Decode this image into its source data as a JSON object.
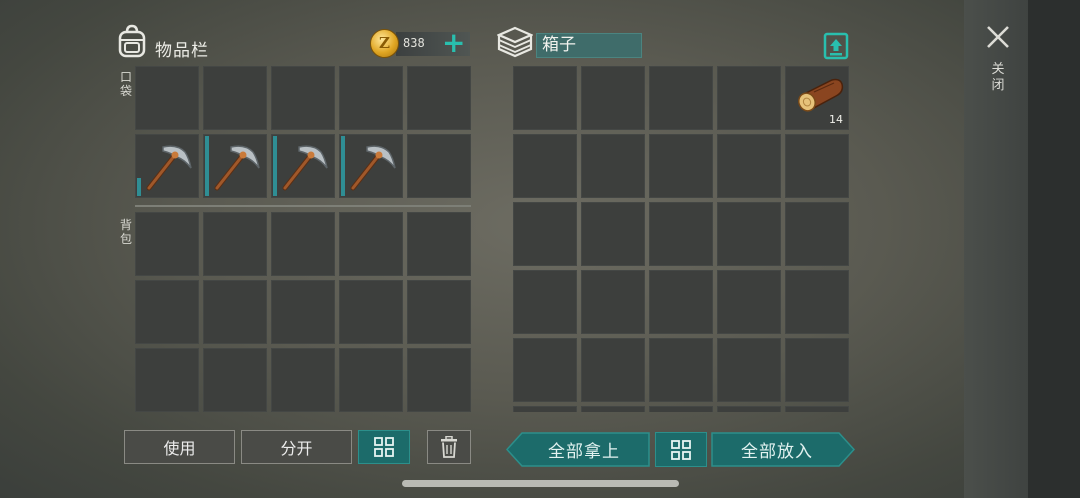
{
  "inventory": {
    "title": "物品栏",
    "coins": "838",
    "pocket_label": "口袋",
    "backpack_label": "背包",
    "pocket_rows": [
      [
        {
          "item": ""
        },
        {
          "item": ""
        },
        {
          "item": ""
        },
        {
          "item": ""
        },
        {
          "item": ""
        }
      ],
      [
        {
          "item": "pickaxe-icon",
          "edge": "part"
        },
        {
          "item": "pickaxe-icon",
          "edge": "full"
        },
        {
          "item": "pickaxe-icon",
          "edge": "full"
        },
        {
          "item": "pickaxe-icon",
          "edge": "full"
        },
        {
          "item": ""
        }
      ]
    ],
    "backpack_rows": 3
  },
  "container": {
    "name": "箱子",
    "first_item": {
      "icon": "wood-log-icon",
      "qty": "14"
    }
  },
  "buttons": {
    "use": "使用",
    "split": "分开",
    "take_all": "全部拿上",
    "put_all": "全部放入"
  },
  "close": {
    "label": "关闭"
  },
  "colors": {
    "accent": "#29bfae",
    "teal_button": "#1c6b6a",
    "slot": "#3d3f3d"
  }
}
